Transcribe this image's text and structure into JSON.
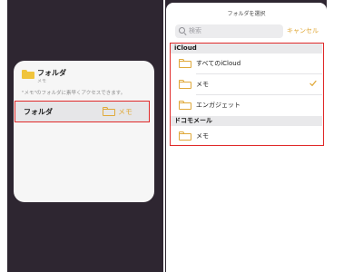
{
  "widget": {
    "title": "フォルダ",
    "subtitle": "メモ",
    "description": "\"メモ\"のフォルダに素早くアクセスできます。",
    "folder_row": {
      "label": "フォルダ",
      "value": "メモ"
    }
  },
  "picker": {
    "title": "フォルダを選択",
    "search_placeholder": "検索",
    "cancel_label": "キャンセル",
    "sections": [
      {
        "header": "iCloud",
        "items": [
          {
            "label": "すべてのiCloud",
            "checked": false
          },
          {
            "label": "メモ",
            "checked": true
          },
          {
            "label": "エンガジェット",
            "checked": false
          }
        ]
      },
      {
        "header": "ドコモメール",
        "items": [
          {
            "label": "メモ",
            "checked": false
          }
        ]
      }
    ]
  },
  "colors": {
    "accent": "#e0a93a",
    "highlight_border": "#e02a2a",
    "dark_background": "#2e2631",
    "folder_icon_fill": "#f0c43c"
  },
  "icons": {
    "widget_folder": "folder-icon",
    "row_folder": "folder-outline-icon",
    "search": "search-icon",
    "selected": "checkmark-icon"
  }
}
